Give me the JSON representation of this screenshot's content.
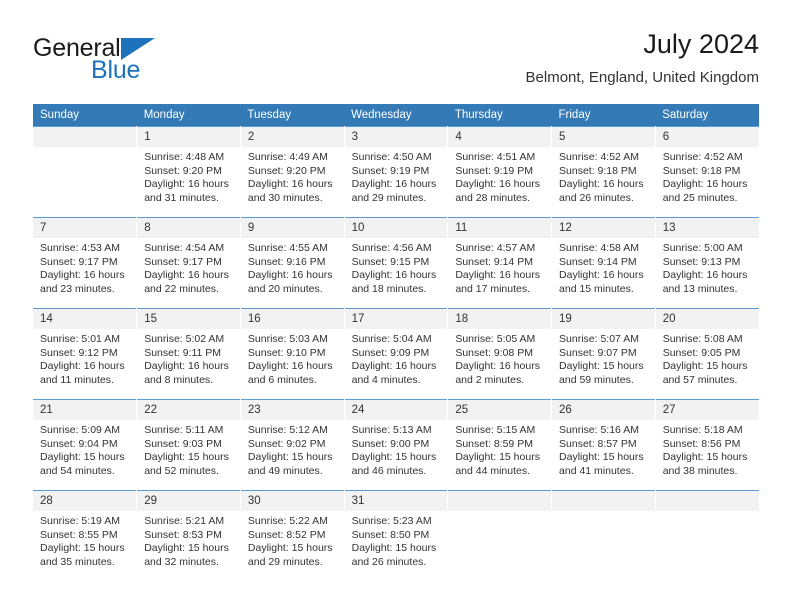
{
  "brand": {
    "name_part1": "General",
    "name_part2": "Blue",
    "logo_icon": "triangle-flag-icon"
  },
  "header": {
    "title": "July 2024",
    "location": "Belmont, England, United Kingdom"
  },
  "calendar": {
    "weekday_headers": [
      "Sunday",
      "Monday",
      "Tuesday",
      "Wednesday",
      "Thursday",
      "Friday",
      "Saturday"
    ],
    "accent_color": "#337ab7",
    "daynum_band_color": "#f2f2f2",
    "row_separator_color": "#5b9bd5",
    "weeks": [
      [
        {
          "day": "",
          "sunrise": "",
          "sunset": "",
          "daylight_line1": "",
          "daylight_line2": ""
        },
        {
          "day": "1",
          "sunrise": "Sunrise: 4:48 AM",
          "sunset": "Sunset: 9:20 PM",
          "daylight_line1": "Daylight: 16 hours",
          "daylight_line2": "and 31 minutes."
        },
        {
          "day": "2",
          "sunrise": "Sunrise: 4:49 AM",
          "sunset": "Sunset: 9:20 PM",
          "daylight_line1": "Daylight: 16 hours",
          "daylight_line2": "and 30 minutes."
        },
        {
          "day": "3",
          "sunrise": "Sunrise: 4:50 AM",
          "sunset": "Sunset: 9:19 PM",
          "daylight_line1": "Daylight: 16 hours",
          "daylight_line2": "and 29 minutes."
        },
        {
          "day": "4",
          "sunrise": "Sunrise: 4:51 AM",
          "sunset": "Sunset: 9:19 PM",
          "daylight_line1": "Daylight: 16 hours",
          "daylight_line2": "and 28 minutes."
        },
        {
          "day": "5",
          "sunrise": "Sunrise: 4:52 AM",
          "sunset": "Sunset: 9:18 PM",
          "daylight_line1": "Daylight: 16 hours",
          "daylight_line2": "and 26 minutes."
        },
        {
          "day": "6",
          "sunrise": "Sunrise: 4:52 AM",
          "sunset": "Sunset: 9:18 PM",
          "daylight_line1": "Daylight: 16 hours",
          "daylight_line2": "and 25 minutes."
        }
      ],
      [
        {
          "day": "7",
          "sunrise": "Sunrise: 4:53 AM",
          "sunset": "Sunset: 9:17 PM",
          "daylight_line1": "Daylight: 16 hours",
          "daylight_line2": "and 23 minutes."
        },
        {
          "day": "8",
          "sunrise": "Sunrise: 4:54 AM",
          "sunset": "Sunset: 9:17 PM",
          "daylight_line1": "Daylight: 16 hours",
          "daylight_line2": "and 22 minutes."
        },
        {
          "day": "9",
          "sunrise": "Sunrise: 4:55 AM",
          "sunset": "Sunset: 9:16 PM",
          "daylight_line1": "Daylight: 16 hours",
          "daylight_line2": "and 20 minutes."
        },
        {
          "day": "10",
          "sunrise": "Sunrise: 4:56 AM",
          "sunset": "Sunset: 9:15 PM",
          "daylight_line1": "Daylight: 16 hours",
          "daylight_line2": "and 18 minutes."
        },
        {
          "day": "11",
          "sunrise": "Sunrise: 4:57 AM",
          "sunset": "Sunset: 9:14 PM",
          "daylight_line1": "Daylight: 16 hours",
          "daylight_line2": "and 17 minutes."
        },
        {
          "day": "12",
          "sunrise": "Sunrise: 4:58 AM",
          "sunset": "Sunset: 9:14 PM",
          "daylight_line1": "Daylight: 16 hours",
          "daylight_line2": "and 15 minutes."
        },
        {
          "day": "13",
          "sunrise": "Sunrise: 5:00 AM",
          "sunset": "Sunset: 9:13 PM",
          "daylight_line1": "Daylight: 16 hours",
          "daylight_line2": "and 13 minutes."
        }
      ],
      [
        {
          "day": "14",
          "sunrise": "Sunrise: 5:01 AM",
          "sunset": "Sunset: 9:12 PM",
          "daylight_line1": "Daylight: 16 hours",
          "daylight_line2": "and 11 minutes."
        },
        {
          "day": "15",
          "sunrise": "Sunrise: 5:02 AM",
          "sunset": "Sunset: 9:11 PM",
          "daylight_line1": "Daylight: 16 hours",
          "daylight_line2": "and 8 minutes."
        },
        {
          "day": "16",
          "sunrise": "Sunrise: 5:03 AM",
          "sunset": "Sunset: 9:10 PM",
          "daylight_line1": "Daylight: 16 hours",
          "daylight_line2": "and 6 minutes."
        },
        {
          "day": "17",
          "sunrise": "Sunrise: 5:04 AM",
          "sunset": "Sunset: 9:09 PM",
          "daylight_line1": "Daylight: 16 hours",
          "daylight_line2": "and 4 minutes."
        },
        {
          "day": "18",
          "sunrise": "Sunrise: 5:05 AM",
          "sunset": "Sunset: 9:08 PM",
          "daylight_line1": "Daylight: 16 hours",
          "daylight_line2": "and 2 minutes."
        },
        {
          "day": "19",
          "sunrise": "Sunrise: 5:07 AM",
          "sunset": "Sunset: 9:07 PM",
          "daylight_line1": "Daylight: 15 hours",
          "daylight_line2": "and 59 minutes."
        },
        {
          "day": "20",
          "sunrise": "Sunrise: 5:08 AM",
          "sunset": "Sunset: 9:05 PM",
          "daylight_line1": "Daylight: 15 hours",
          "daylight_line2": "and 57 minutes."
        }
      ],
      [
        {
          "day": "21",
          "sunrise": "Sunrise: 5:09 AM",
          "sunset": "Sunset: 9:04 PM",
          "daylight_line1": "Daylight: 15 hours",
          "daylight_line2": "and 54 minutes."
        },
        {
          "day": "22",
          "sunrise": "Sunrise: 5:11 AM",
          "sunset": "Sunset: 9:03 PM",
          "daylight_line1": "Daylight: 15 hours",
          "daylight_line2": "and 52 minutes."
        },
        {
          "day": "23",
          "sunrise": "Sunrise: 5:12 AM",
          "sunset": "Sunset: 9:02 PM",
          "daylight_line1": "Daylight: 15 hours",
          "daylight_line2": "and 49 minutes."
        },
        {
          "day": "24",
          "sunrise": "Sunrise: 5:13 AM",
          "sunset": "Sunset: 9:00 PM",
          "daylight_line1": "Daylight: 15 hours",
          "daylight_line2": "and 46 minutes."
        },
        {
          "day": "25",
          "sunrise": "Sunrise: 5:15 AM",
          "sunset": "Sunset: 8:59 PM",
          "daylight_line1": "Daylight: 15 hours",
          "daylight_line2": "and 44 minutes."
        },
        {
          "day": "26",
          "sunrise": "Sunrise: 5:16 AM",
          "sunset": "Sunset: 8:57 PM",
          "daylight_line1": "Daylight: 15 hours",
          "daylight_line2": "and 41 minutes."
        },
        {
          "day": "27",
          "sunrise": "Sunrise: 5:18 AM",
          "sunset": "Sunset: 8:56 PM",
          "daylight_line1": "Daylight: 15 hours",
          "daylight_line2": "and 38 minutes."
        }
      ],
      [
        {
          "day": "28",
          "sunrise": "Sunrise: 5:19 AM",
          "sunset": "Sunset: 8:55 PM",
          "daylight_line1": "Daylight: 15 hours",
          "daylight_line2": "and 35 minutes."
        },
        {
          "day": "29",
          "sunrise": "Sunrise: 5:21 AM",
          "sunset": "Sunset: 8:53 PM",
          "daylight_line1": "Daylight: 15 hours",
          "daylight_line2": "and 32 minutes."
        },
        {
          "day": "30",
          "sunrise": "Sunrise: 5:22 AM",
          "sunset": "Sunset: 8:52 PM",
          "daylight_line1": "Daylight: 15 hours",
          "daylight_line2": "and 29 minutes."
        },
        {
          "day": "31",
          "sunrise": "Sunrise: 5:23 AM",
          "sunset": "Sunset: 8:50 PM",
          "daylight_line1": "Daylight: 15 hours",
          "daylight_line2": "and 26 minutes."
        },
        {
          "day": "",
          "sunrise": "",
          "sunset": "",
          "daylight_line1": "",
          "daylight_line2": ""
        },
        {
          "day": "",
          "sunrise": "",
          "sunset": "",
          "daylight_line1": "",
          "daylight_line2": ""
        },
        {
          "day": "",
          "sunrise": "",
          "sunset": "",
          "daylight_line1": "",
          "daylight_line2": ""
        }
      ]
    ]
  }
}
